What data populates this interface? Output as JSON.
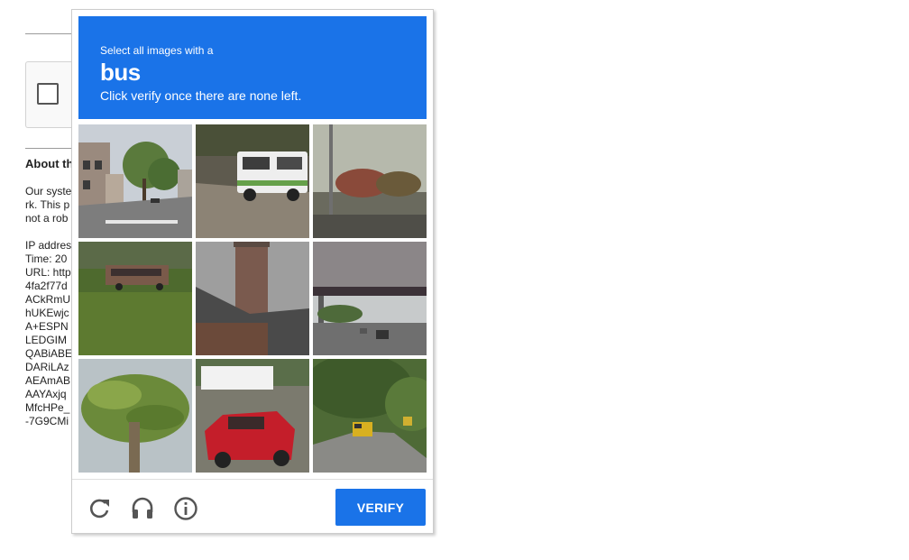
{
  "background_page": {
    "about_title": "About th",
    "paragraph_lines": [
      "Our syste",
      "rk. This p",
      "not a rob"
    ],
    "info_lines": [
      "IP addres",
      "Time: 20",
      "URL: http",
      "4fa2f77d",
      "ACkRmU",
      "hUKEwjc",
      "A+ESPN",
      "LEDGIM",
      "QABiABE",
      "DARiLAz",
      "AEAmAB",
      "AAYAxjq",
      "MfcHPe_",
      "-7G9CMi"
    ]
  },
  "captcha": {
    "header": {
      "instruction_prefix": "Select all images with a",
      "target": "bus",
      "instruction_suffix": "Click verify once there are none left."
    },
    "tiles": [
      {
        "scene": "street with houses and tree",
        "selected": false
      },
      {
        "scene": "white bus on road",
        "selected": false
      },
      {
        "scene": "pole with shrubs",
        "selected": false
      },
      {
        "scene": "distant bus on grassy field",
        "selected": false
      },
      {
        "scene": "chimney on house",
        "selected": false
      },
      {
        "scene": "highway under bridge",
        "selected": false
      },
      {
        "scene": "palm tree",
        "selected": false
      },
      {
        "scene": "red car and truck",
        "selected": false
      },
      {
        "scene": "yellow vehicle on wooded road",
        "selected": false
      }
    ],
    "footer": {
      "icons": [
        "reload-icon",
        "audio-icon",
        "info-icon"
      ],
      "verify_label": "VERIFY"
    },
    "colors": {
      "accent": "#1a73e8",
      "icon": "#555555"
    }
  }
}
